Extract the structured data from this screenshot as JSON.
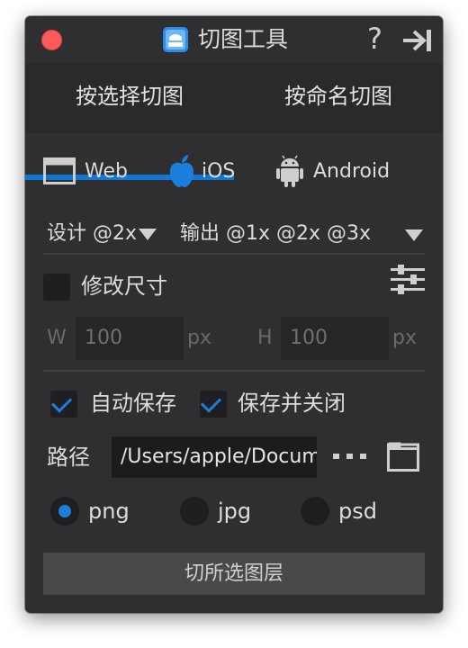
{
  "window": {
    "title": "切图工具",
    "help": "?"
  },
  "tabs": [
    {
      "label": "按选择切图",
      "active": true
    },
    {
      "label": "按命名切图",
      "active": false
    }
  ],
  "platforms": [
    {
      "label": "Web"
    },
    {
      "label": "iOS"
    },
    {
      "label": "Android"
    }
  ],
  "design": {
    "label": "设计 @2x"
  },
  "output": {
    "label": "输出 @1x @2x @3x"
  },
  "resize": {
    "label": "修改尺寸",
    "checked": false
  },
  "size": {
    "w_label": "W",
    "w_value": "100",
    "w_unit": "px",
    "h_label": "H",
    "h_value": "100",
    "h_unit": "px"
  },
  "options": [
    {
      "label": "自动保存",
      "checked": true
    },
    {
      "label": "保存并关闭",
      "checked": true
    }
  ],
  "path": {
    "label": "路径",
    "value": "/Users/apple/Documents"
  },
  "formats": [
    {
      "label": "png",
      "selected": true
    },
    {
      "label": "jpg",
      "selected": false
    },
    {
      "label": "psd",
      "selected": false
    }
  ],
  "action": {
    "label": "切所选图层"
  },
  "colors": {
    "accent": "#1277d3",
    "close": "#fd5b5b",
    "panel": "#2f2f31"
  }
}
